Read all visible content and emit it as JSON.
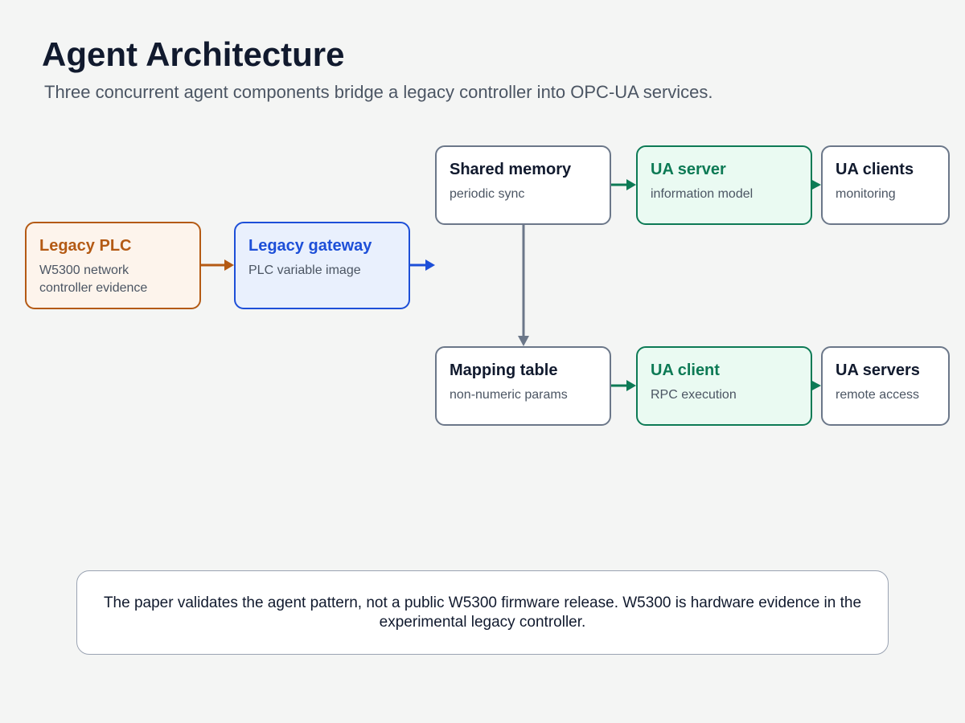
{
  "title": "Agent Architecture",
  "subtitle": "Three concurrent agent components bridge a legacy controller into OPC-UA services.",
  "nodes": {
    "legacy_plc": {
      "name": "Legacy PLC",
      "desc": "W5300 network controller evidence"
    },
    "legacy_gateway": {
      "name": "Legacy gateway",
      "desc": "PLC variable image"
    },
    "shared_memory": {
      "name": "Shared memory",
      "desc": "periodic sync"
    },
    "ua_server": {
      "name": "UA server",
      "desc": "information model"
    },
    "ua_clients": {
      "name": "UA clients",
      "desc": "monitoring"
    },
    "mapping_table": {
      "name": "Mapping table",
      "desc": "non-numeric params"
    },
    "ua_client": {
      "name": "UA client",
      "desc": "RPC execution"
    },
    "ua_servers": {
      "name": "UA servers",
      "desc": "remote access"
    }
  },
  "edges": [
    {
      "from": "legacy_plc",
      "to": "legacy_gateway"
    },
    {
      "from": "legacy_gateway",
      "to": "shared_memory"
    },
    {
      "from": "shared_memory",
      "to": "ua_server"
    },
    {
      "from": "ua_server",
      "to": "ua_clients"
    },
    {
      "from": "shared_memory",
      "to": "mapping_table"
    },
    {
      "from": "mapping_table",
      "to": "ua_client"
    },
    {
      "from": "ua_client",
      "to": "ua_servers"
    }
  ],
  "note": "The paper validates the agent pattern, not a public W5300 firmware release. W5300 is hardware evidence in the experimental legacy controller.",
  "colors": {
    "orange": "#b45a14",
    "blue": "#1d4fd8",
    "green": "#0d7a55",
    "gray": "#6b7789",
    "background": "#f4f5f4"
  }
}
